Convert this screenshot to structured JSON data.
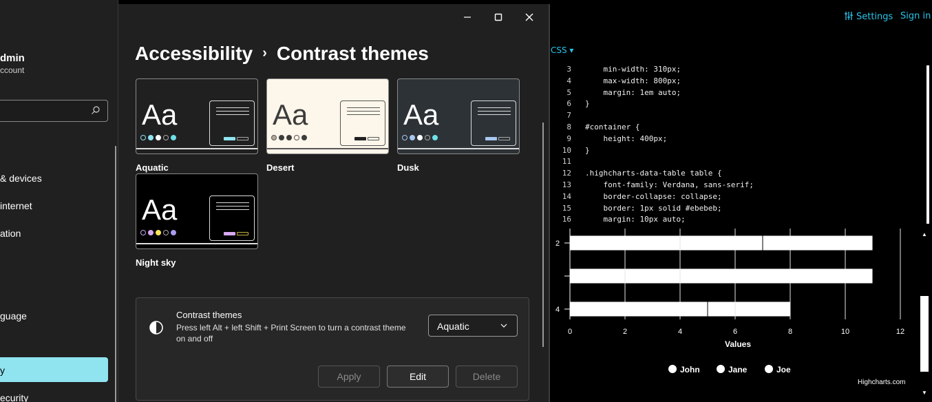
{
  "sidebar": {
    "user_name": "dmin",
    "user_account": "ccount",
    "items": [
      {
        "label": "& devices"
      },
      {
        "label": " internet"
      },
      {
        "label": "ation"
      },
      {
        "label": "guage"
      },
      {
        "label": "y"
      },
      {
        "label": "ecurity"
      }
    ]
  },
  "window": {
    "breadcrumb_parent": "Accessibility",
    "breadcrumb_current": "Contrast themes"
  },
  "themes": [
    {
      "label": "Aquatic"
    },
    {
      "label": "Desert"
    },
    {
      "label": "Dusk"
    },
    {
      "label": "Night sky"
    }
  ],
  "card": {
    "title": "Contrast themes",
    "description": "Press left Alt + left Shift + Print Screen to turn a contrast theme on and off",
    "selected_theme": "Aquatic",
    "apply_label": "Apply",
    "edit_label": "Edit",
    "delete_label": "Delete"
  },
  "editor": {
    "settings_label": "Settings",
    "signin_label": "Sign in",
    "tab_label": "CSS ▾",
    "code_lines": [
      {
        "n": "3",
        "text": "    min-width: 310px;"
      },
      {
        "n": "4",
        "text": "    max-width: 800px;"
      },
      {
        "n": "5",
        "text": "    margin: 1em auto;"
      },
      {
        "n": "6",
        "text": "}"
      },
      {
        "n": "7",
        "text": ""
      },
      {
        "n": "8",
        "text": "#container {"
      },
      {
        "n": "9",
        "text": "    height: 400px;"
      },
      {
        "n": "10",
        "text": "}"
      },
      {
        "n": "11",
        "text": ""
      },
      {
        "n": "12",
        "text": ".highcharts-data-table table {"
      },
      {
        "n": "13",
        "text": "    font-family: Verdana, sans-serif;"
      },
      {
        "n": "14",
        "text": "    border-collapse: collapse;"
      },
      {
        "n": "15",
        "text": "    border: 1px solid #ebebeb;"
      },
      {
        "n": "16",
        "text": "    margin: 10px auto;"
      }
    ],
    "credits": "Highcharts.com"
  },
  "chart_data": {
    "type": "bar",
    "stacked": true,
    "categories": [
      "2",
      "",
      "4"
    ],
    "series": [
      {
        "name": "John",
        "values": [
          4,
          2,
          5
        ]
      },
      {
        "name": "Jane",
        "values": [
          3,
          2,
          1
        ]
      },
      {
        "name": "Joe",
        "values": [
          4,
          7,
          2
        ]
      }
    ],
    "xlabel": "Values",
    "xlim": [
      0,
      12
    ],
    "x_ticks": [
      "0",
      "2",
      "4",
      "6",
      "8",
      "10",
      "12"
    ],
    "legend_placement": "bottom",
    "bar_color": "#ffffff"
  }
}
